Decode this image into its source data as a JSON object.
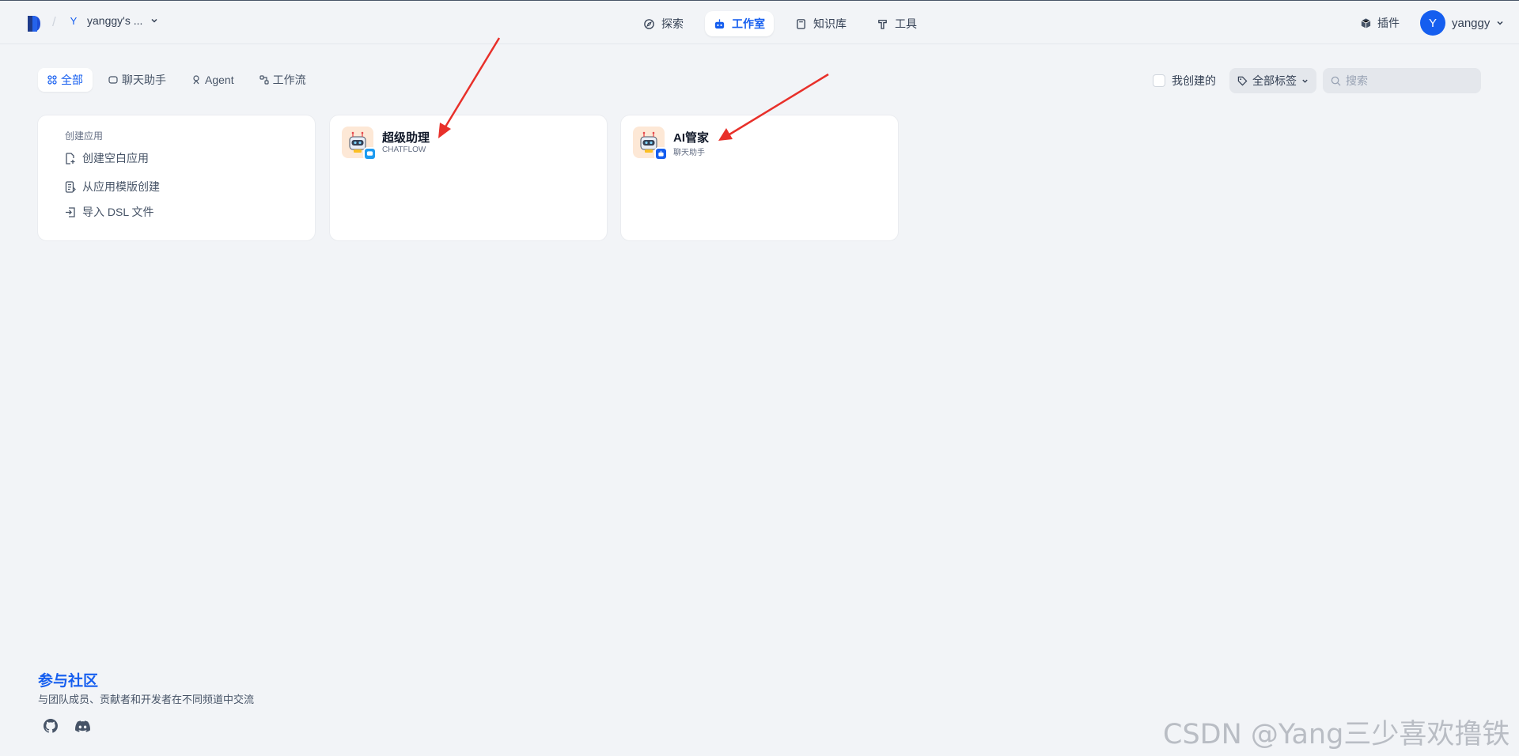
{
  "header": {
    "workspace_letter": "Y",
    "workspace_name": "yanggy's ...",
    "nav": [
      {
        "label": "探索",
        "icon": "compass-icon"
      },
      {
        "label": "工作室",
        "icon": "robot-icon"
      },
      {
        "label": "知识库",
        "icon": "book-icon"
      },
      {
        "label": "工具",
        "icon": "hammer-icon"
      }
    ],
    "plugins_label": "插件",
    "user_initial": "Y",
    "user_name": "yanggy"
  },
  "filters": {
    "tabs": [
      {
        "label": "全部"
      },
      {
        "label": "聊天助手"
      },
      {
        "label": "Agent"
      },
      {
        "label": "工作流"
      }
    ],
    "mine_label": "我创建的",
    "tags_label": "全部标签",
    "search_placeholder": "搜索"
  },
  "create_card": {
    "title": "创建应用",
    "items": [
      {
        "label": "创建空白应用"
      },
      {
        "label": "从应用模版创建"
      },
      {
        "label": "导入 DSL 文件"
      }
    ]
  },
  "apps": [
    {
      "name": "超级助理",
      "type": "CHATFLOW",
      "badge_color": "#1d9bf0"
    },
    {
      "name": "AI管家",
      "type": "聊天助手",
      "badge_color": "#155eef"
    }
  ],
  "community": {
    "title": "参与社区",
    "subtitle": "与团队成员、贡献者和开发者在不同频道中交流"
  },
  "watermark": "CSDN @Yang三少喜欢撸铁",
  "colors": {
    "accent": "#155eef",
    "annotation_arrow": "#e8302a"
  }
}
